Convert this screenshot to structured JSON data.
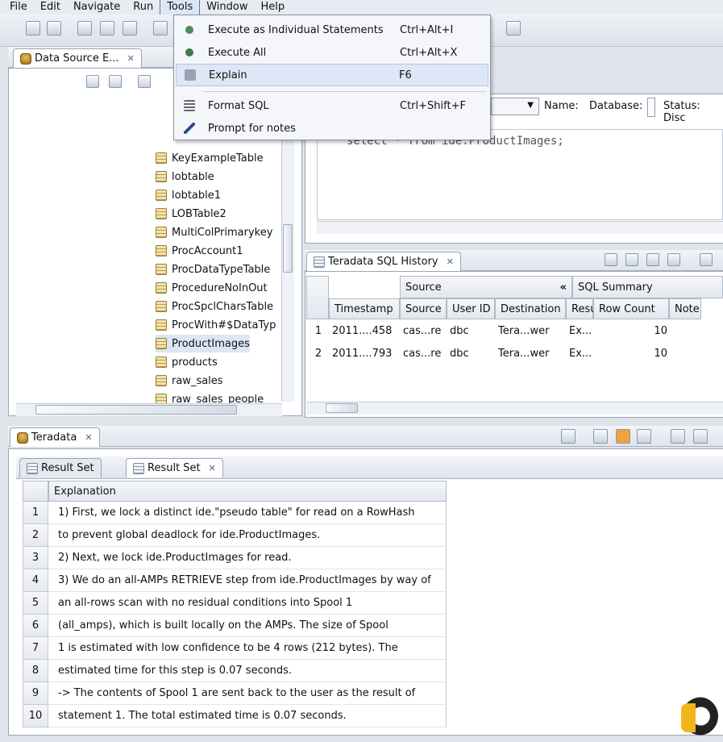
{
  "menubar": [
    "File",
    "Edit",
    "Navigate",
    "Run",
    "Tools",
    "Window",
    "Help"
  ],
  "tools_menu": [
    {
      "label": "Execute as Individual Statements",
      "shortcut": "Ctrl+Alt+I"
    },
    {
      "label": "Execute All",
      "shortcut": "Ctrl+Alt+X"
    },
    {
      "label": "Explain",
      "shortcut": "F6"
    },
    {
      "label": "Format SQL",
      "shortcut": "Ctrl+Shift+F"
    },
    {
      "label": "Prompt for notes",
      "shortcut": ""
    }
  ],
  "datasource_tab": "Data Source E...",
  "tree_items": [
    "KeyExampleTable",
    "lobtable",
    "lobtable1",
    "LOBTable2",
    "MultiColPrimarykey",
    "ProcAccount1",
    "ProcDataTypeTable",
    "ProcedureNoInOut",
    "ProcSpclCharsTable",
    "ProcWith#$DataTyp",
    "ProductImages",
    "products",
    "raw_sales",
    "raw_sales_people"
  ],
  "editor": {
    "name_label": "Name:",
    "database_label": "Database:",
    "status_label": "Status: Disc",
    "sql": "select * from ide.ProductImages;"
  },
  "history": {
    "tab": "Teradata SQL History",
    "group_source": "Source",
    "group_collapse": "«",
    "group_summary": "SQL Summary",
    "columns": [
      "Timestamp",
      "Source",
      "User ID",
      "Destination",
      "Result",
      "Row Count",
      "Note"
    ],
    "rows": [
      [
        "1",
        "2011....458",
        "cas...re",
        "dbc",
        "Tera...wer",
        "Ex...",
        "10",
        ""
      ],
      [
        "2",
        "2011....793",
        "cas...re",
        "dbc",
        "Tera...wer",
        "Ex...",
        "10",
        ""
      ]
    ]
  },
  "result_panel": {
    "tab": "Teradata",
    "subtabs": [
      "Result Set",
      "Result Set"
    ],
    "column": "Explanation",
    "rows": [
      "1) First, we lock a distinct ide.\"pseudo table\" for read on a RowHash",
      "  to prevent global deadlock for ide.ProductImages.",
      "2) Next, we lock ide.ProductImages for read.",
      "3) We do an all-AMPs RETRIEVE step from ide.ProductImages by way of",
      "  an all-rows scan with no residual conditions into Spool 1",
      "  (all_amps), which is built locally on the AMPs.  The size of Spool",
      "  1 is estimated with low confidence to be 4 rows (212 bytes).  The",
      "  estimated time for this step is 0.07 seconds.",
      "-> The contents of Spool 1 are sent back to the user as the result of",
      "  statement 1.  The total estimated time is 0.07 seconds."
    ],
    "row_numbers": [
      "1",
      "2",
      "3",
      "4",
      "5",
      "6",
      "7",
      "8",
      "9",
      "10"
    ]
  },
  "colors": {
    "accent": "#dbe6f6",
    "border": "#9aa6b7"
  }
}
